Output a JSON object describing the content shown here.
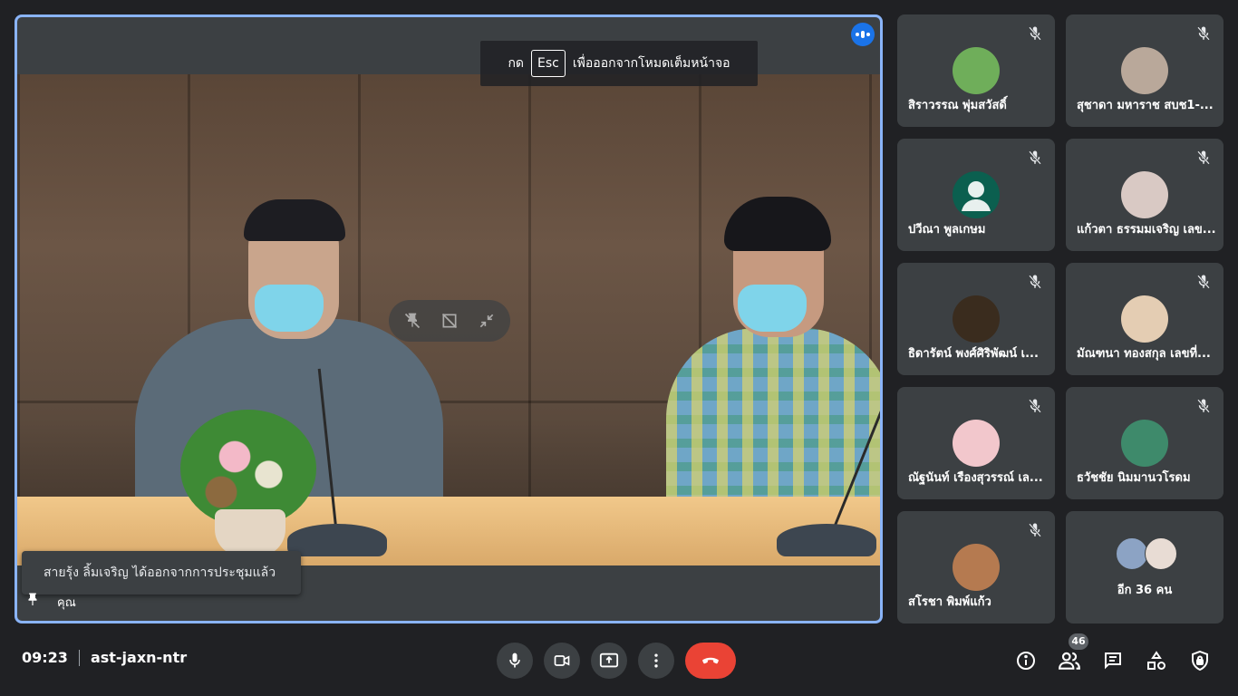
{
  "meeting": {
    "time": "09:23",
    "code": "ast-jaxn-ntr",
    "participant_count": "46"
  },
  "fullscreen_hint": {
    "prefix": "กด",
    "key": "Esc",
    "suffix": "เพื่อออกจากโหมดเต็มหน้าจอ"
  },
  "notification": {
    "text": "สายรุ้ง ลิ้มเจริญ ได้ออกจากการประชุมแล้ว"
  },
  "self_label": "คุณ",
  "participants": [
    {
      "name": "สิราวรรณ พุ่มสวัสดิ์",
      "avatar_color": "#6fae5a"
    },
    {
      "name": "สุชาดา มหาราช สบช1-...",
      "avatar_color": "#b9a89a"
    },
    {
      "name": "ปวีณา พูลเกษม",
      "avatar_color": "#0b5f4f",
      "avatar_icon": "person-icon"
    },
    {
      "name": "แก้วตา ธรรมมเจริญ เลข...",
      "avatar_color": "#d9c9c4"
    },
    {
      "name": "ธิดารัตน์ พงศ์ศิริพัฒน์ เ...",
      "avatar_color": "#3a2c1e"
    },
    {
      "name": "มัณฑนา ทองสกุล เลขที่...",
      "avatar_color": "#e4cdb3"
    },
    {
      "name": "ณัฐนันท์ เรืองสุวรรณ์ เล...",
      "avatar_color": "#f2c7cc"
    },
    {
      "name": "ธวัชชัย นิมมานวโรดม",
      "avatar_color": "#3e8a6b"
    },
    {
      "name": "สโรชา พิมพ์แก้ว",
      "avatar_color": "#b57a50"
    }
  ],
  "others": {
    "label": "อีก 36 คน",
    "avatar_colors": [
      "#8ca3c4",
      "#e8dcd4"
    ]
  },
  "colors": {
    "background": "#202124",
    "tile": "#3c4043",
    "active_border": "#8ab4f8",
    "end_call": "#ea4335",
    "speaking": "#1a73e8"
  }
}
